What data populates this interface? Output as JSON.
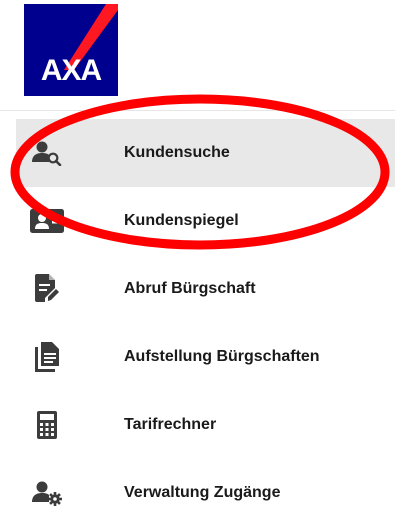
{
  "brand": {
    "logo_text": "AXA",
    "logo_bg": "#00008f",
    "logo_stripe": "#ff1721"
  },
  "nav": {
    "items": [
      {
        "label": "Kundensuche",
        "icon": "user-search-icon",
        "active": true
      },
      {
        "label": "Kundenspiegel",
        "icon": "contact-card-icon",
        "active": false
      },
      {
        "label": "Abruf Bürgschaft",
        "icon": "document-edit-icon",
        "active": false
      },
      {
        "label": "Aufstellung Bürgschaften",
        "icon": "documents-list-icon",
        "active": false
      },
      {
        "label": "Tarifrechner",
        "icon": "calculator-icon",
        "active": false
      },
      {
        "label": "Verwaltung Zugänge",
        "icon": "user-settings-icon",
        "active": false
      }
    ]
  },
  "colors": {
    "icon": "#3c3c3c",
    "active_bg": "#e8e8e8",
    "annotation": "#ff0000"
  }
}
